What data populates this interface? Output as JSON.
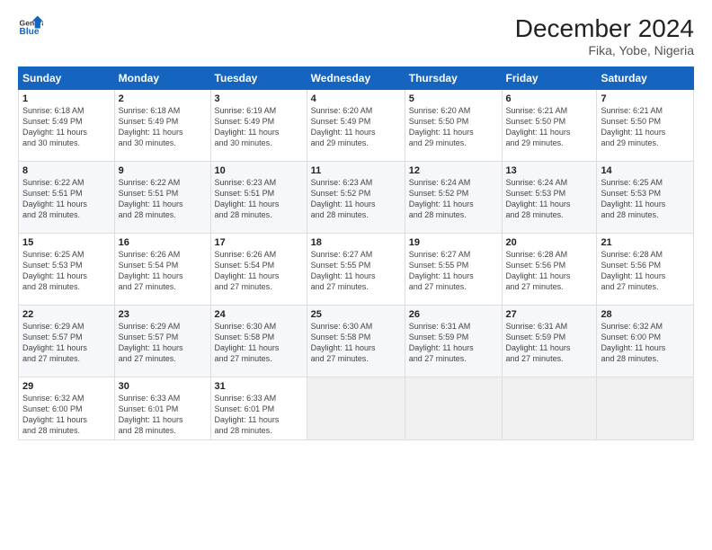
{
  "header": {
    "logo_general": "General",
    "logo_blue": "Blue",
    "month": "December 2024",
    "location": "Fika, Yobe, Nigeria"
  },
  "days_of_week": [
    "Sunday",
    "Monday",
    "Tuesday",
    "Wednesday",
    "Thursday",
    "Friday",
    "Saturday"
  ],
  "weeks": [
    [
      {
        "day": "1",
        "info": "Sunrise: 6:18 AM\nSunset: 5:49 PM\nDaylight: 11 hours\nand 30 minutes."
      },
      {
        "day": "2",
        "info": "Sunrise: 6:18 AM\nSunset: 5:49 PM\nDaylight: 11 hours\nand 30 minutes."
      },
      {
        "day": "3",
        "info": "Sunrise: 6:19 AM\nSunset: 5:49 PM\nDaylight: 11 hours\nand 30 minutes."
      },
      {
        "day": "4",
        "info": "Sunrise: 6:20 AM\nSunset: 5:49 PM\nDaylight: 11 hours\nand 29 minutes."
      },
      {
        "day": "5",
        "info": "Sunrise: 6:20 AM\nSunset: 5:50 PM\nDaylight: 11 hours\nand 29 minutes."
      },
      {
        "day": "6",
        "info": "Sunrise: 6:21 AM\nSunset: 5:50 PM\nDaylight: 11 hours\nand 29 minutes."
      },
      {
        "day": "7",
        "info": "Sunrise: 6:21 AM\nSunset: 5:50 PM\nDaylight: 11 hours\nand 29 minutes."
      }
    ],
    [
      {
        "day": "8",
        "info": "Sunrise: 6:22 AM\nSunset: 5:51 PM\nDaylight: 11 hours\nand 28 minutes."
      },
      {
        "day": "9",
        "info": "Sunrise: 6:22 AM\nSunset: 5:51 PM\nDaylight: 11 hours\nand 28 minutes."
      },
      {
        "day": "10",
        "info": "Sunrise: 6:23 AM\nSunset: 5:51 PM\nDaylight: 11 hours\nand 28 minutes."
      },
      {
        "day": "11",
        "info": "Sunrise: 6:23 AM\nSunset: 5:52 PM\nDaylight: 11 hours\nand 28 minutes."
      },
      {
        "day": "12",
        "info": "Sunrise: 6:24 AM\nSunset: 5:52 PM\nDaylight: 11 hours\nand 28 minutes."
      },
      {
        "day": "13",
        "info": "Sunrise: 6:24 AM\nSunset: 5:53 PM\nDaylight: 11 hours\nand 28 minutes."
      },
      {
        "day": "14",
        "info": "Sunrise: 6:25 AM\nSunset: 5:53 PM\nDaylight: 11 hours\nand 28 minutes."
      }
    ],
    [
      {
        "day": "15",
        "info": "Sunrise: 6:25 AM\nSunset: 5:53 PM\nDaylight: 11 hours\nand 28 minutes."
      },
      {
        "day": "16",
        "info": "Sunrise: 6:26 AM\nSunset: 5:54 PM\nDaylight: 11 hours\nand 27 minutes."
      },
      {
        "day": "17",
        "info": "Sunrise: 6:26 AM\nSunset: 5:54 PM\nDaylight: 11 hours\nand 27 minutes."
      },
      {
        "day": "18",
        "info": "Sunrise: 6:27 AM\nSunset: 5:55 PM\nDaylight: 11 hours\nand 27 minutes."
      },
      {
        "day": "19",
        "info": "Sunrise: 6:27 AM\nSunset: 5:55 PM\nDaylight: 11 hours\nand 27 minutes."
      },
      {
        "day": "20",
        "info": "Sunrise: 6:28 AM\nSunset: 5:56 PM\nDaylight: 11 hours\nand 27 minutes."
      },
      {
        "day": "21",
        "info": "Sunrise: 6:28 AM\nSunset: 5:56 PM\nDaylight: 11 hours\nand 27 minutes."
      }
    ],
    [
      {
        "day": "22",
        "info": "Sunrise: 6:29 AM\nSunset: 5:57 PM\nDaylight: 11 hours\nand 27 minutes."
      },
      {
        "day": "23",
        "info": "Sunrise: 6:29 AM\nSunset: 5:57 PM\nDaylight: 11 hours\nand 27 minutes."
      },
      {
        "day": "24",
        "info": "Sunrise: 6:30 AM\nSunset: 5:58 PM\nDaylight: 11 hours\nand 27 minutes."
      },
      {
        "day": "25",
        "info": "Sunrise: 6:30 AM\nSunset: 5:58 PM\nDaylight: 11 hours\nand 27 minutes."
      },
      {
        "day": "26",
        "info": "Sunrise: 6:31 AM\nSunset: 5:59 PM\nDaylight: 11 hours\nand 27 minutes."
      },
      {
        "day": "27",
        "info": "Sunrise: 6:31 AM\nSunset: 5:59 PM\nDaylight: 11 hours\nand 27 minutes."
      },
      {
        "day": "28",
        "info": "Sunrise: 6:32 AM\nSunset: 6:00 PM\nDaylight: 11 hours\nand 28 minutes."
      }
    ],
    [
      {
        "day": "29",
        "info": "Sunrise: 6:32 AM\nSunset: 6:00 PM\nDaylight: 11 hours\nand 28 minutes."
      },
      {
        "day": "30",
        "info": "Sunrise: 6:33 AM\nSunset: 6:01 PM\nDaylight: 11 hours\nand 28 minutes."
      },
      {
        "day": "31",
        "info": "Sunrise: 6:33 AM\nSunset: 6:01 PM\nDaylight: 11 hours\nand 28 minutes."
      },
      null,
      null,
      null,
      null
    ]
  ]
}
